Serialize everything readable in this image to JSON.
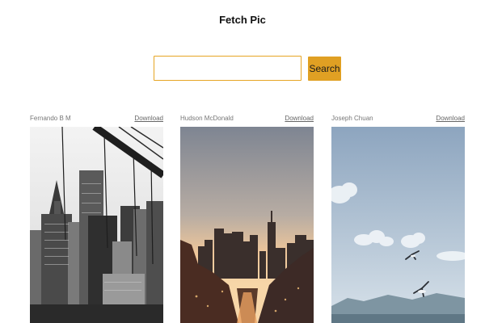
{
  "app": {
    "title": "Fetch Pic"
  },
  "search": {
    "value": "",
    "placeholder": "",
    "button_label": "Search"
  },
  "accent_color": "#e0a023",
  "photos": [
    {
      "author": "Fernando B M",
      "download_label": "Download",
      "subject": "black-and-white skyscrapers behind a suspension bridge cable"
    },
    {
      "author": "Hudson McDonald",
      "download_label": "Download",
      "subject": "city skyline at sunset with a long street"
    },
    {
      "author": "Joseph Chuan",
      "download_label": "Download",
      "subject": "cloudy sky with flying seagulls over water"
    }
  ]
}
